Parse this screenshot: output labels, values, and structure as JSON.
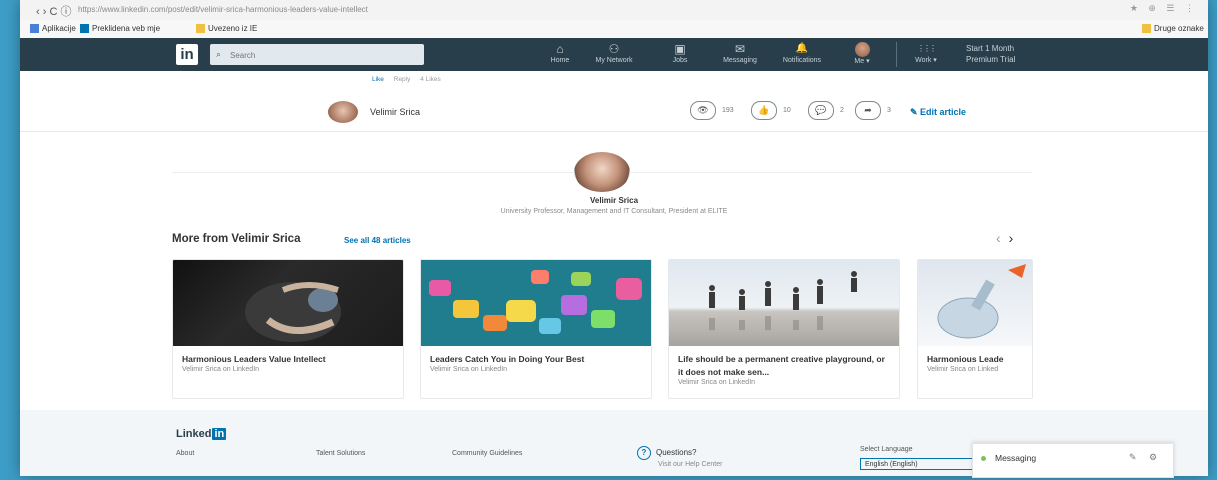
{
  "browser": {
    "nav_icons": "‹  ›  C  ⓘ",
    "url": "https://www.linkedin.com/post/edit/velimir-srica-harmonious-leaders-value-intellect",
    "right_icons": "★ ⊕ ☰ ⋮",
    "bookmarks": [
      {
        "label": "Aplikacije",
        "color": "#4a7fd8"
      },
      {
        "label": "Preklidena veb mje",
        "color": "#0073b1"
      },
      {
        "label": "Uvezeno iz IE",
        "color": "#f0c040"
      },
      {
        "label": "Druge oznake",
        "color": "#f0c040"
      }
    ]
  },
  "linkedin_nav": {
    "logo": "in",
    "search_placeholder": "Search",
    "items": [
      {
        "label": "Home",
        "icon": "home-icon",
        "glyph": "⌂"
      },
      {
        "label": "My Network",
        "icon": "people-icon",
        "glyph": "⚇"
      },
      {
        "label": "Jobs",
        "icon": "briefcase-icon",
        "glyph": "▣"
      },
      {
        "label": "Messaging",
        "icon": "chat-icon",
        "glyph": "✉"
      },
      {
        "label": "Notifications",
        "icon": "bell-icon",
        "glyph": "🔔"
      },
      {
        "label": "Me ▾",
        "icon": "avatar-icon",
        "glyph": ""
      },
      {
        "label": "Work ▾",
        "icon": "grid-icon",
        "glyph": "⋮⋮⋮"
      }
    ],
    "premium_line1": "Start 1 Month",
    "premium_line2": "Premium Trial"
  },
  "crumb": {
    "like": "Like",
    "reply": "Reply",
    "likes": "4 Likes"
  },
  "author_bar": {
    "name": "Velimir Srica",
    "stats": [
      {
        "icon": "eye-icon",
        "glyph": "👁",
        "count": "193"
      },
      {
        "icon": "like-icon",
        "glyph": "👍",
        "count": "10"
      },
      {
        "icon": "comment-icon",
        "glyph": "💬",
        "count": "2"
      },
      {
        "icon": "share-icon",
        "glyph": "➦",
        "count": "3"
      }
    ],
    "edit_label": "✎ Edit article"
  },
  "author": {
    "name": "Velimir Srica",
    "title": "University Professor, Management and IT Consultant, President at ELITE"
  },
  "more": {
    "heading": "More from Velimir Srica",
    "see_all": "See all 48 articles",
    "prev": "‹",
    "next": "›"
  },
  "cards": [
    {
      "title": "Harmonious Leaders Value Intellect",
      "byline": "Velimir Srica on LinkedIn"
    },
    {
      "title": "Leaders Catch You in Doing Your Best",
      "byline": "Velimir Srica on LinkedIn"
    },
    {
      "title": "Life should be a permanent creative playground, or it does not make sen...",
      "byline": "Velimir Srica on LinkedIn"
    },
    {
      "title": "Harmonious Leade",
      "byline": "Velimir Srica on Linked"
    }
  ],
  "footer": {
    "logo_text": "Linked",
    "logo_in": "in",
    "links": [
      "About",
      "Talent Solutions",
      "Community Guidelines"
    ],
    "questions": "Questions?",
    "questions_sub": "Visit our Help Center",
    "lang_label": "Select Language",
    "lang_value": "English (English)"
  },
  "messaging": {
    "label": "Messaging",
    "compose": "✎",
    "settings": "⚙"
  }
}
